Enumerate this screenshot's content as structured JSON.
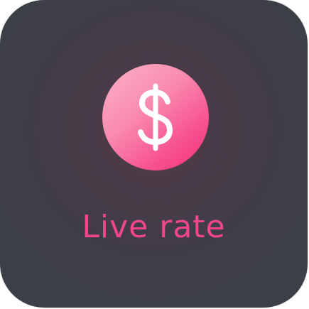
{
  "tile": {
    "label": "Live rate",
    "icon": "dollar-sign-icon"
  },
  "colors": {
    "background": "#3d3f47",
    "accent": "#f2468a",
    "coin_light": "#fbb3c8",
    "coin_dark": "#f22f78",
    "icon": "#ffffff"
  }
}
